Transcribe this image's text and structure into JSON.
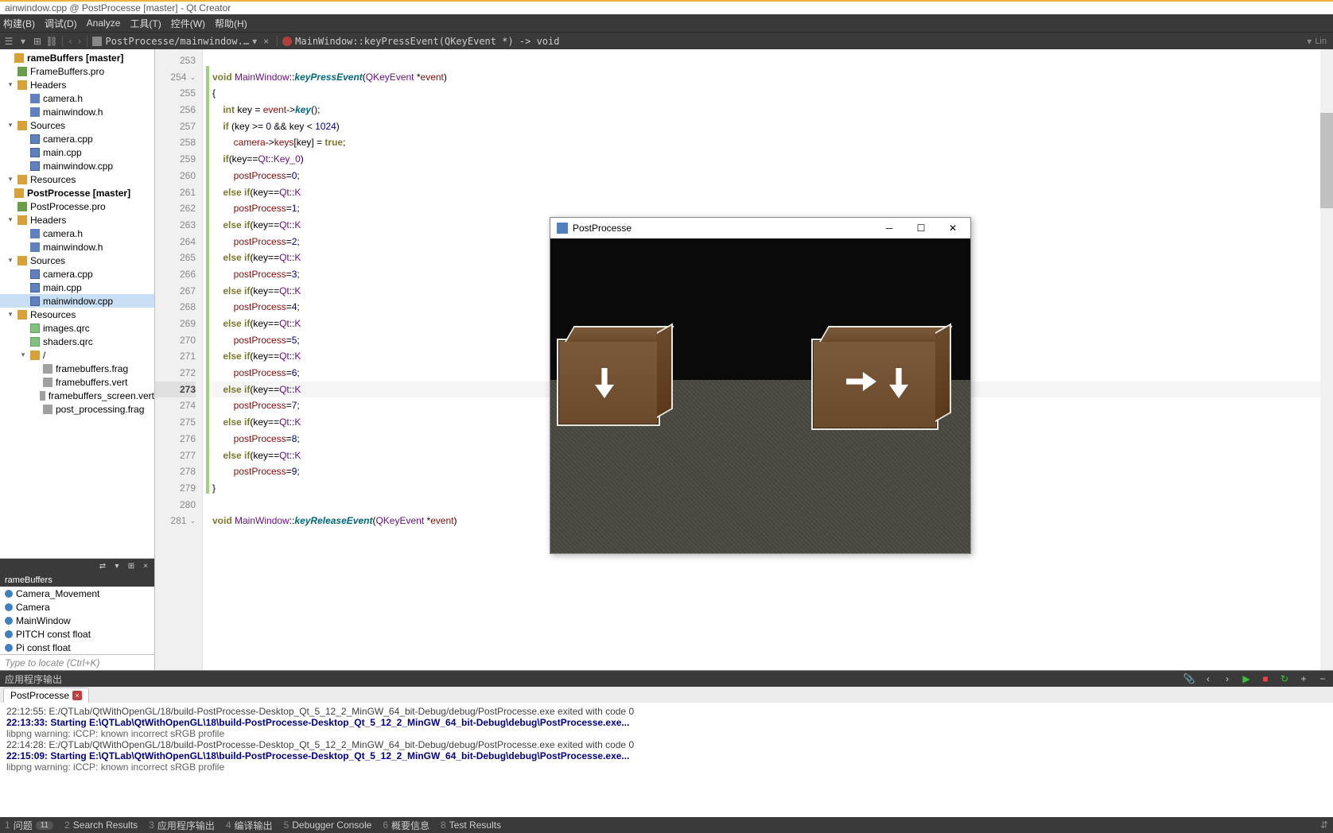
{
  "title": "ainwindow.cpp @ PostProcesse [master] - Qt Creator",
  "menu": [
    "构建(B)",
    "调试(D)",
    "Analyze",
    "工具(T)",
    "控件(W)",
    "帮助(H)"
  ],
  "toolbar": {
    "breadcrumb1": "PostProcesse/mainwindow.…",
    "breadcrumb2": "MainWindow::keyPressEvent(QKeyEvent *) -> void",
    "right": "Lin"
  },
  "tree": [
    {
      "lvl": 0,
      "ico": "folder",
      "label": "rameBuffers [master]",
      "bold": true
    },
    {
      "lvl": 1,
      "ico": "pro",
      "label": "FrameBuffers.pro"
    },
    {
      "lvl": 1,
      "ico": "folder",
      "label": "Headers",
      "arrow": "▾"
    },
    {
      "lvl": 2,
      "ico": "h",
      "label": "camera.h"
    },
    {
      "lvl": 2,
      "ico": "h",
      "label": "mainwindow.h"
    },
    {
      "lvl": 1,
      "ico": "folder",
      "label": "Sources",
      "arrow": "▾"
    },
    {
      "lvl": 2,
      "ico": "cpp",
      "label": "camera.cpp"
    },
    {
      "lvl": 2,
      "ico": "cpp",
      "label": "main.cpp"
    },
    {
      "lvl": 2,
      "ico": "cpp",
      "label": "mainwindow.cpp"
    },
    {
      "lvl": 1,
      "ico": "folder",
      "label": "Resources",
      "arrow": "▾"
    },
    {
      "lvl": 0,
      "ico": "folder",
      "label": "PostProcesse [master]",
      "bold": true
    },
    {
      "lvl": 1,
      "ico": "pro",
      "label": "PostProcesse.pro"
    },
    {
      "lvl": 1,
      "ico": "folder",
      "label": "Headers",
      "arrow": "▾"
    },
    {
      "lvl": 2,
      "ico": "h",
      "label": "camera.h"
    },
    {
      "lvl": 2,
      "ico": "h",
      "label": "mainwindow.h"
    },
    {
      "lvl": 1,
      "ico": "folder",
      "label": "Sources",
      "arrow": "▾"
    },
    {
      "lvl": 2,
      "ico": "cpp",
      "label": "camera.cpp"
    },
    {
      "lvl": 2,
      "ico": "cpp",
      "label": "main.cpp"
    },
    {
      "lvl": 2,
      "ico": "cpp",
      "label": "mainwindow.cpp",
      "sel": true
    },
    {
      "lvl": 1,
      "ico": "folder",
      "label": "Resources",
      "arrow": "▾"
    },
    {
      "lvl": 2,
      "ico": "qrc",
      "label": "images.qrc"
    },
    {
      "lvl": 2,
      "ico": "qrc",
      "label": "shaders.qrc"
    },
    {
      "lvl": 2,
      "ico": "folder",
      "label": "/",
      "arrow": "▾"
    },
    {
      "lvl": 3,
      "ico": "file",
      "label": "framebuffers.frag"
    },
    {
      "lvl": 3,
      "ico": "file",
      "label": "framebuffers.vert"
    },
    {
      "lvl": 3,
      "ico": "file",
      "label": "framebuffers_screen.vert"
    },
    {
      "lvl": 3,
      "ico": "file",
      "label": "post_processing.frag"
    }
  ],
  "classes": {
    "header": "rameBuffers",
    "items": [
      "Camera_Movement",
      "Camera",
      "MainWindow",
      "PITCH const float",
      "Pi const float"
    ]
  },
  "locate_placeholder": "Type to locate (Ctrl+K)",
  "code": {
    "start": 253,
    "current": 273,
    "lines": [
      "",
      "void MainWindow::keyPressEvent(QKeyEvent *event)",
      "{",
      "    int key = event->key();",
      "    if (key >= 0 && key < 1024)",
      "        camera->keys[key] = true;",
      "    if(key==Qt::Key_0)",
      "        postProcess=0;",
      "    else if(key==Qt::K",
      "        postProcess=1;",
      "    else if(key==Qt::K",
      "        postProcess=2;",
      "    else if(key==Qt::K",
      "        postProcess=3;",
      "    else if(key==Qt::K",
      "        postProcess=4;",
      "    else if(key==Qt::K",
      "        postProcess=5;",
      "    else if(key==Qt::K",
      "        postProcess=6;",
      "    else if(key==Qt::K",
      "        postProcess=7;",
      "    else if(key==Qt::K",
      "        postProcess=8;",
      "    else if(key==Qt::K",
      "        postProcess=9;",
      "}",
      "",
      "void MainWindow::keyReleaseEvent(QKeyEvent *event)"
    ]
  },
  "app_title": "PostProcesse",
  "output": {
    "header": "应用程序输出",
    "tab": "PostProcesse",
    "lines": [
      {
        "t": "22:12:55: E:/QTLab/QtWithOpenGL/18/build-PostProcesse-Desktop_Qt_5_12_2_MinGW_64_bit-Debug/debug/PostProcesse.exe exited with code 0",
        "c": "bold"
      },
      {
        "t": "",
        "c": ""
      },
      {
        "t": "22:13:33: Starting E:\\QTLab\\QtWithOpenGL\\18\\build-PostProcesse-Desktop_Qt_5_12_2_MinGW_64_bit-Debug\\debug\\PostProcesse.exe...",
        "c": "blue"
      },
      {
        "t": "libpng warning: iCCP: known incorrect sRGB profile",
        "c": ""
      },
      {
        "t": "22:14:28: E:/QTLab/QtWithOpenGL/18/build-PostProcesse-Desktop_Qt_5_12_2_MinGW_64_bit-Debug/debug/PostProcesse.exe exited with code 0",
        "c": "bold"
      },
      {
        "t": "",
        "c": ""
      },
      {
        "t": "22:15:09: Starting E:\\QTLab\\QtWithOpenGL\\18\\build-PostProcesse-Desktop_Qt_5_12_2_MinGW_64_bit-Debug\\debug\\PostProcesse.exe...",
        "c": "blue"
      },
      {
        "t": "libpng warning: iCCP: known incorrect sRGB profile",
        "c": ""
      }
    ]
  },
  "status": [
    {
      "n": "1",
      "t": "问题",
      "badge": "11"
    },
    {
      "n": "2",
      "t": "Search Results"
    },
    {
      "n": "3",
      "t": "应用程序输出"
    },
    {
      "n": "4",
      "t": "编译输出"
    },
    {
      "n": "5",
      "t": "Debugger Console"
    },
    {
      "n": "6",
      "t": "概要信息"
    },
    {
      "n": "8",
      "t": "Test Results"
    }
  ]
}
